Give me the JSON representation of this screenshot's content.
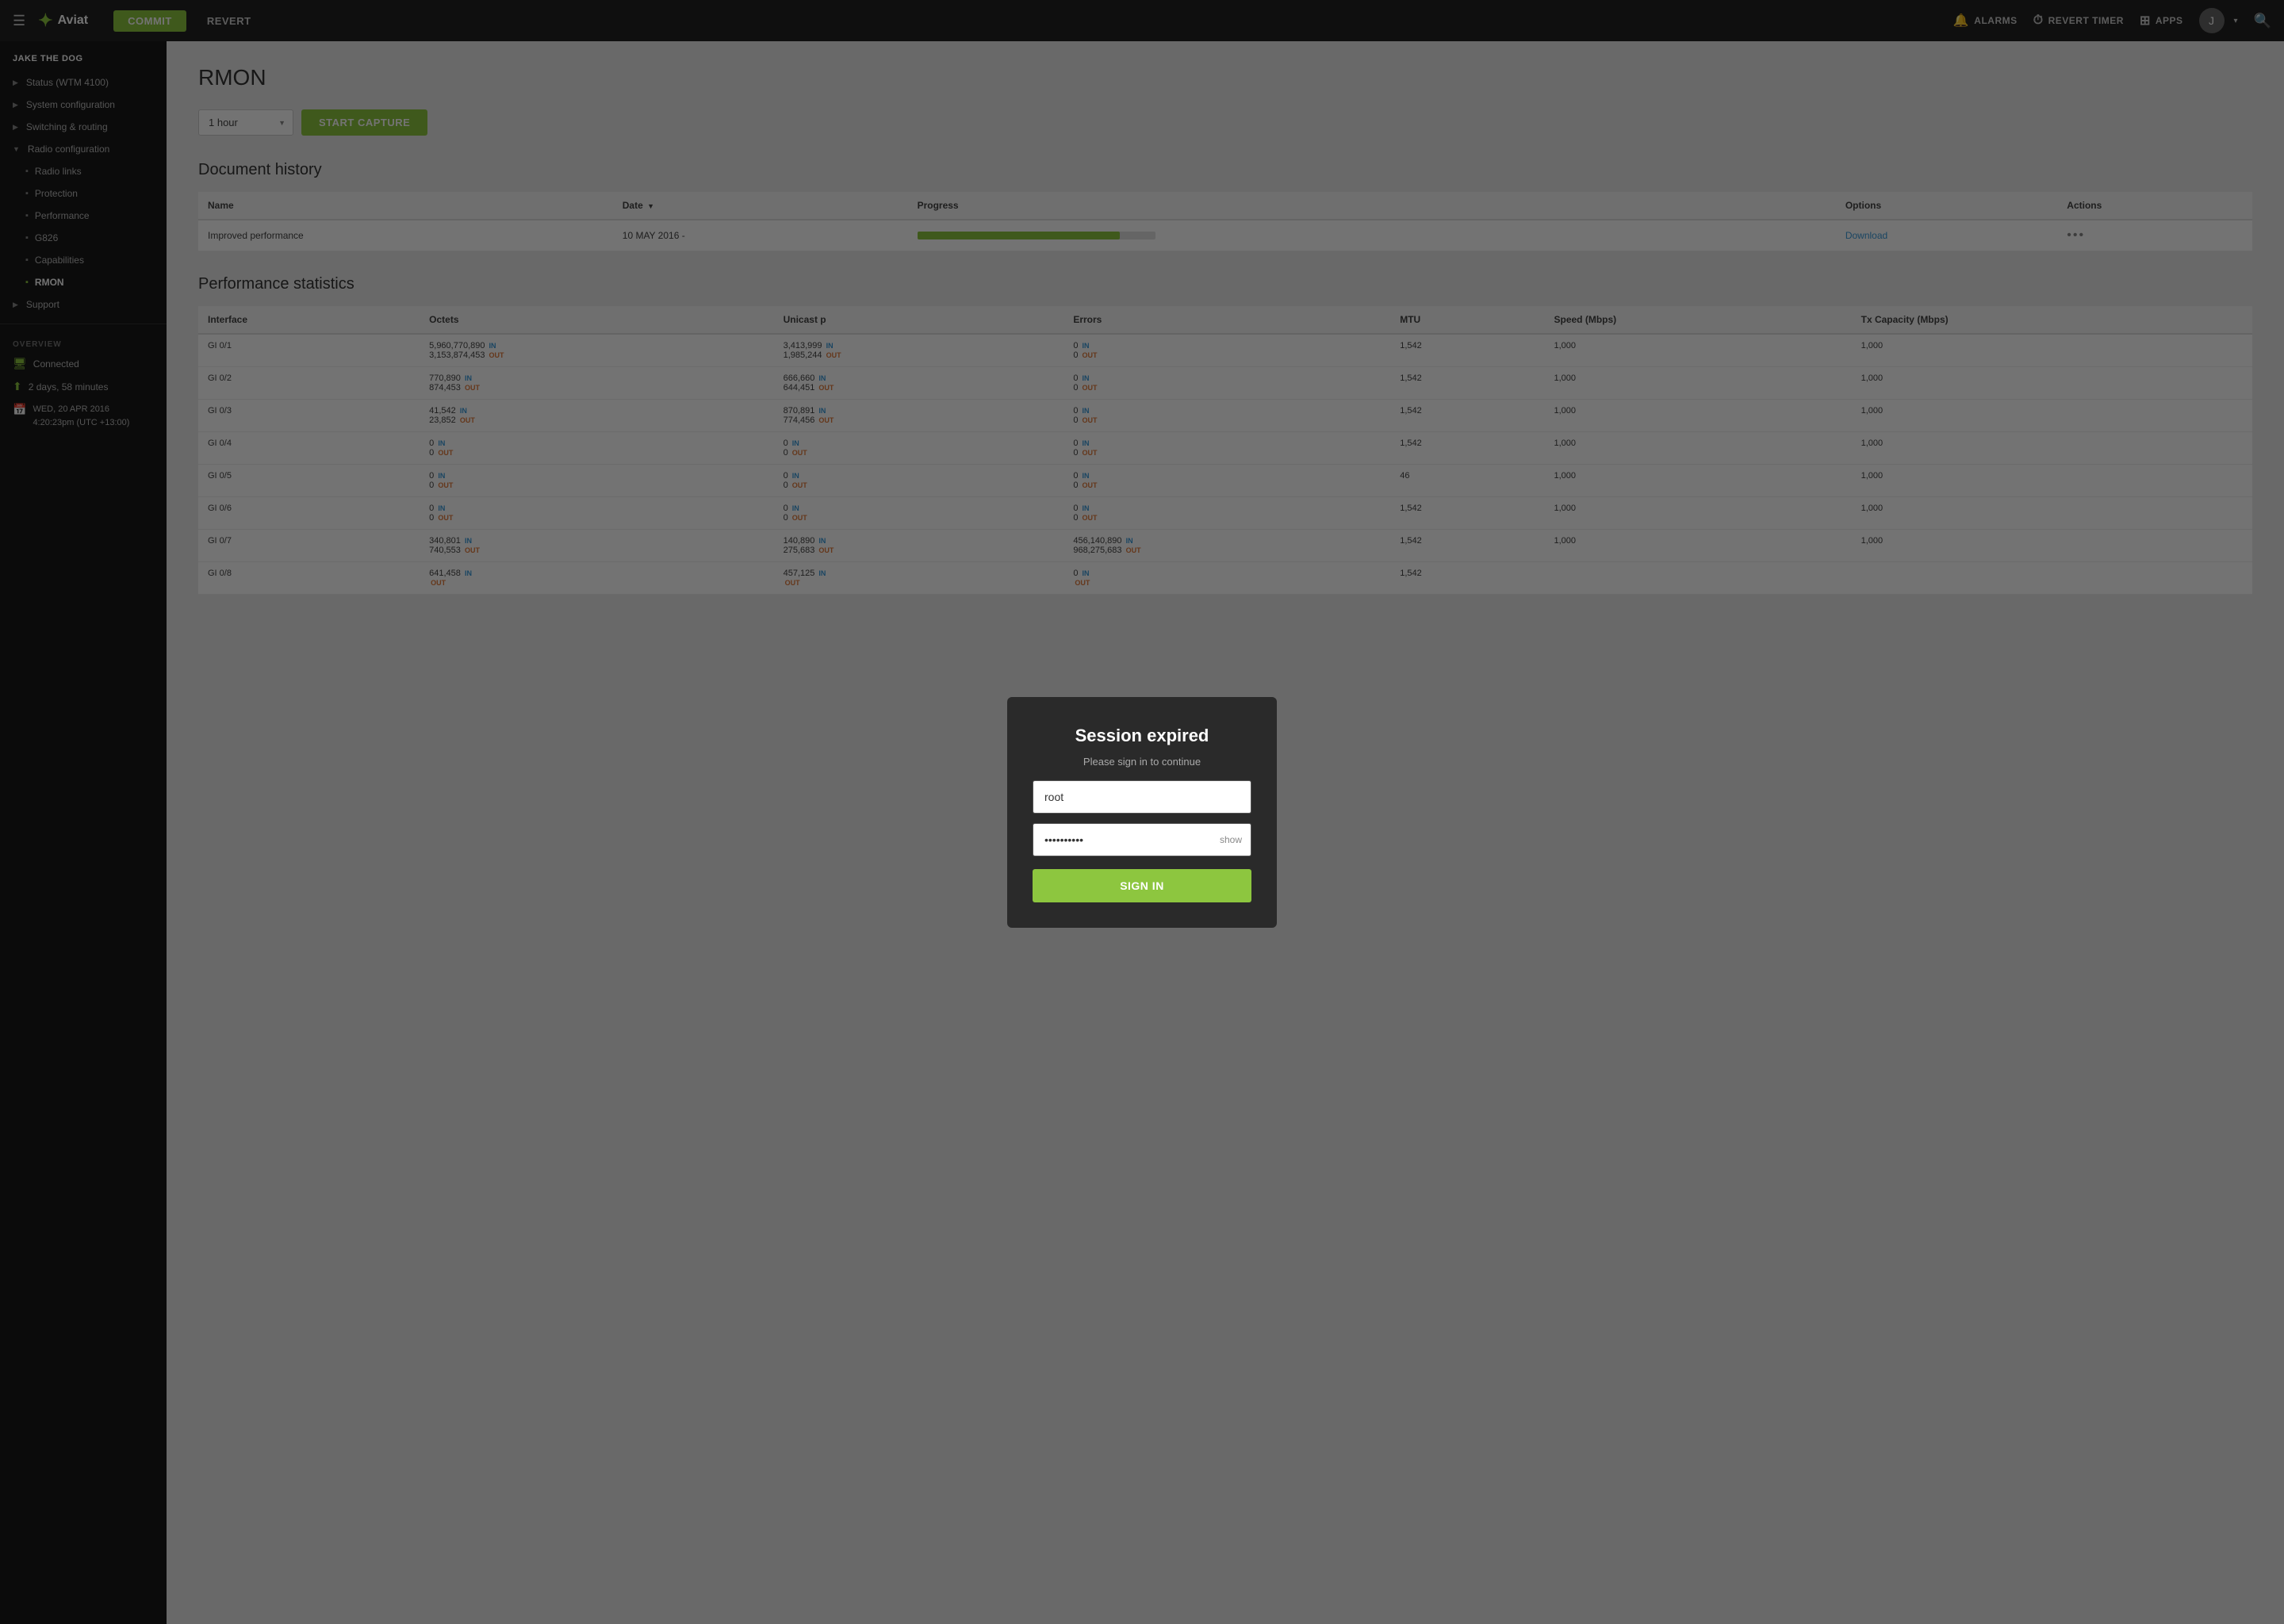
{
  "topNav": {
    "hamburger": "☰",
    "logoText": "Aviat",
    "commitLabel": "COMMIT",
    "revertLabel": "REVERT",
    "alarmsLabel": "ALARMS",
    "revertTimerLabel": "REVERT TIMER",
    "appsLabel": "APPS",
    "avatarInitial": "J",
    "chevron": "▾"
  },
  "sidebar": {
    "username": "JAKE THE DOG",
    "items": [
      {
        "label": "Status (WTM 4100)",
        "type": "arrow-item",
        "arrow": "▶"
      },
      {
        "label": "System configuration",
        "type": "arrow-item",
        "arrow": "▶"
      },
      {
        "label": "Switching & routing",
        "type": "arrow-item",
        "arrow": "▶"
      },
      {
        "label": "Radio configuration",
        "type": "arrow-item",
        "arrow": "▼",
        "expanded": true
      },
      {
        "label": "Radio links",
        "type": "sub-item"
      },
      {
        "label": "Protection",
        "type": "sub-item"
      },
      {
        "label": "Performance",
        "type": "sub-item"
      },
      {
        "label": "G826",
        "type": "sub-item"
      },
      {
        "label": "Capabilities",
        "type": "sub-item"
      },
      {
        "label": "RMON",
        "type": "sub-item-active"
      },
      {
        "label": "Support",
        "type": "arrow-item",
        "arrow": "▶"
      }
    ],
    "overviewTitle": "OVERVIEW",
    "overviewItems": [
      {
        "label": "Connected",
        "iconType": "monitor"
      },
      {
        "label": "2 days, 58 minutes",
        "iconType": "up-arrow"
      },
      {
        "label": "WED, 20 APR 2016\n4:20:23pm (UTC +13:00)",
        "iconType": "calendar"
      }
    ]
  },
  "main": {
    "pageTitle": "RMON",
    "captureSection": {
      "hourOption": "1 hour",
      "startCaptureLabel": "START CAPTURE"
    },
    "docHistory": {
      "sectionTitle": "Document history",
      "columns": [
        "Name",
        "Date",
        "Progress",
        "Options",
        "Actions"
      ],
      "rows": [
        {
          "name": "Improved performance",
          "date": "10 MAY 2016 -",
          "progressPercent": 85,
          "optionsLink": "Download",
          "actions": "•••"
        }
      ]
    },
    "perfStats": {
      "sectionTitle": "Performance statistics",
      "columns": [
        "Interface",
        "Octets",
        "Unicast p",
        "Errors",
        "MTU",
        "Speed (Mbps)",
        "Tx Capacity (Mbps)"
      ],
      "rows": [
        {
          "iface": "GI 0/1",
          "octets_in": "5,960,770,890",
          "octets_out": "3,153,874,453",
          "unicast_in": "3,413,999",
          "unicast_out": "1,985,244",
          "errors_in": "0",
          "errors_out": "0",
          "mtu": "1,542",
          "speed": "1,000",
          "txcap": "1,000"
        },
        {
          "iface": "GI 0/2",
          "octets_in": "770,890",
          "octets_out": "874,453",
          "unicast_in": "666,660",
          "unicast_out": "644,451",
          "errors_in": "0",
          "errors_out": "0",
          "mtu": "1,542",
          "speed": "1,000",
          "txcap": "1,000"
        },
        {
          "iface": "GI 0/3",
          "octets_in": "41,542",
          "octets_out": "23,852",
          "unicast_in": "870,891",
          "unicast_out": "774,456",
          "errors_in": "0",
          "errors_out": "0",
          "mtu": "1,542",
          "speed": "1,000",
          "txcap": "1,000"
        },
        {
          "iface": "GI 0/4",
          "octets_in": "0",
          "octets_out": "0",
          "unicast_in": "0",
          "unicast_out": "0",
          "errors_in": "0",
          "errors_out": "0",
          "mtu": "1,542",
          "speed": "1,000",
          "txcap": "1,000"
        },
        {
          "iface": "GI 0/5",
          "octets_in": "0",
          "octets_out": "0",
          "unicast_in": "0",
          "unicast_out": "0",
          "errors_in": "0",
          "errors_out": "0",
          "mtu": "46",
          "speed": "1,000",
          "txcap": "1,000"
        },
        {
          "iface": "GI 0/6",
          "octets_in": "0",
          "octets_out": "0",
          "unicast_in": "0",
          "unicast_out": "0",
          "errors_in": "0",
          "errors_out": "0",
          "mtu": "1,542",
          "speed": "1,000",
          "txcap": "1,000"
        },
        {
          "iface": "GI 0/7",
          "octets_in": "340,801",
          "octets_out": "740,553",
          "unicast_in": "140,890",
          "unicast_out": "275,683",
          "errors_in": "456,140,890",
          "errors_out": "968,275,683",
          "mtu": "1,542",
          "speed": "1,000",
          "txcap": "1,000"
        },
        {
          "iface": "GI 0/8",
          "octets_in": "641,458",
          "octets_out": "",
          "unicast_in": "457,125",
          "unicast_out": "",
          "errors_in": "0",
          "errors_out": "",
          "mtu": "1,542",
          "speed": "",
          "txcap": ""
        }
      ]
    }
  },
  "modal": {
    "title": "Session expired",
    "subtitle": "Please sign in to continue",
    "usernamePlaceholder": "root",
    "usernameValue": "root",
    "passwordValue": "••••••••••",
    "showLabel": "show",
    "signInLabel": "SIGN IN"
  }
}
